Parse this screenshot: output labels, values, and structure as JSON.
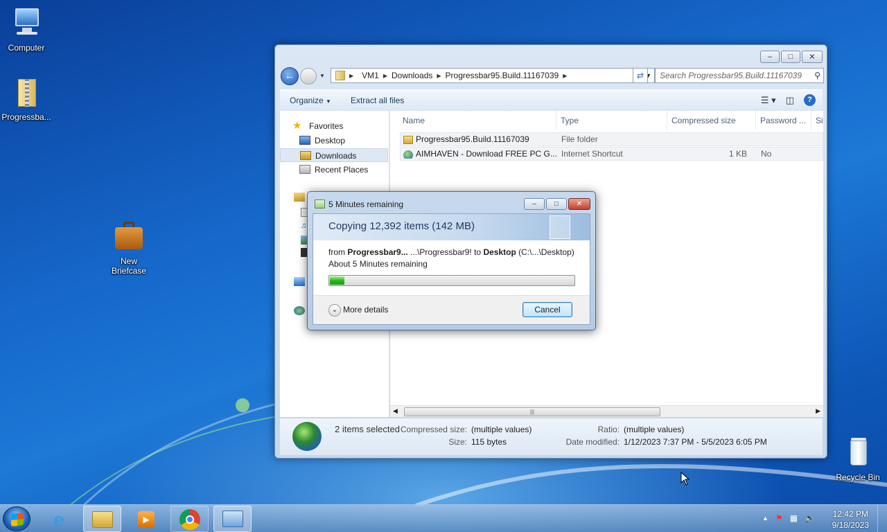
{
  "desktop": {
    "icons": [
      {
        "label": "Computer"
      },
      {
        "label": "Progressba..."
      },
      {
        "label_line1": "New",
        "label_line2": "Briefcase"
      },
      {
        "label": "Recycle Bin"
      }
    ]
  },
  "explorer": {
    "address": {
      "segments": [
        "VM1",
        "Downloads",
        "Progressbar95.Build.11167039"
      ]
    },
    "search_placeholder": "Search Progressbar95.Build.11167039",
    "toolbar": {
      "organize": "Organize",
      "extract": "Extract all files"
    },
    "nav": {
      "favorites": "Favorites",
      "items": [
        "Desktop",
        "Downloads",
        "Recent Places"
      ],
      "selected": "Downloads"
    },
    "columns": [
      "Name",
      "Type",
      "Compressed size",
      "Password ...",
      "Si"
    ],
    "files": [
      {
        "name": "Progressbar95.Build.11167039",
        "type": "File folder",
        "size": "",
        "password": ""
      },
      {
        "name": "AIMHAVEN - Download FREE PC G...",
        "type": "Internet Shortcut",
        "size": "1 KB",
        "password": "No"
      }
    ],
    "details": {
      "selected": "2 items selected",
      "compressed_size_label": "Compressed size:",
      "compressed_size_value": "(multiple values)",
      "size_label": "Size:",
      "size_value": "115 bytes",
      "ratio_label": "Ratio:",
      "ratio_value": "(multiple values)",
      "modified_label": "Date modified:",
      "modified_value": "1/12/2023 7:37 PM - 5/5/2023 6:05 PM"
    }
  },
  "dialog": {
    "title": "5 Minutes remaining",
    "heading": "Copying 12,392 items (142 MB)",
    "from_prefix": "from ",
    "from_bold": "Progressbar9...",
    "from_mid": " ...\\Progressbar9! to ",
    "to_bold": "Desktop",
    "to_suffix": " (C:\\...\\Desktop)",
    "about": "About 5 Minutes remaining",
    "progress_fraction": 0.06,
    "more_details": "More details",
    "cancel": "Cancel"
  },
  "taskbar": {
    "time": "12:42 PM",
    "date": "9/18/2023"
  },
  "colors": {
    "progress": "#22b21c",
    "accent": "#1d78d6"
  }
}
